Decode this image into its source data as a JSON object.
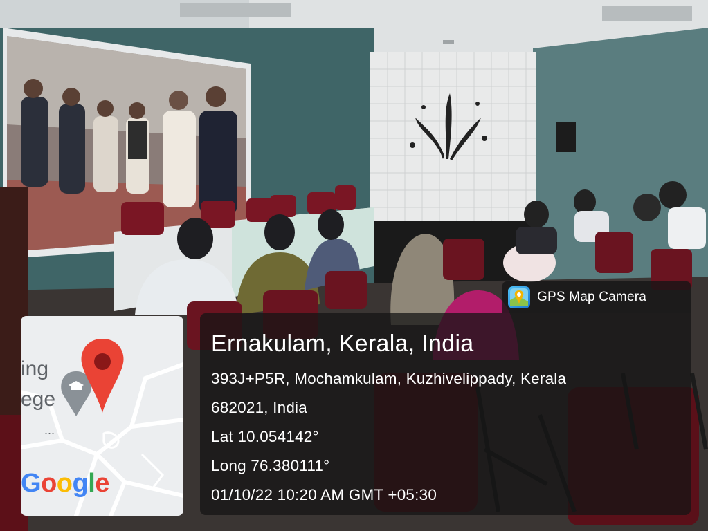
{
  "app_badge": {
    "icon": "gps-map-camera-icon",
    "label": "GPS Map Camera"
  },
  "location": {
    "place": "Ernakulam, Kerala, India",
    "address_line1": "393J+P5R, Mochamkulam, Kuzhivelippady, Kerala",
    "address_line2": "682021, India",
    "latitude": "Lat 10.054142°",
    "longitude": "Long 76.380111°",
    "timestamp": "01/10/22 10:20 AM GMT +05:30"
  },
  "map": {
    "label_line1": "ing",
    "label_line2": "ege",
    "ellipsis": "...",
    "logo_letters": [
      "G",
      "o",
      "o",
      "g",
      "l",
      "e"
    ],
    "logo_colors": [
      "#4285F4",
      "#EA4335",
      "#FBBC05",
      "#4285F4",
      "#34A853",
      "#EA4335"
    ],
    "pin_color": "#EA4335",
    "pin_icon": "map-pin-icon",
    "poi_icon": "school-icon"
  }
}
